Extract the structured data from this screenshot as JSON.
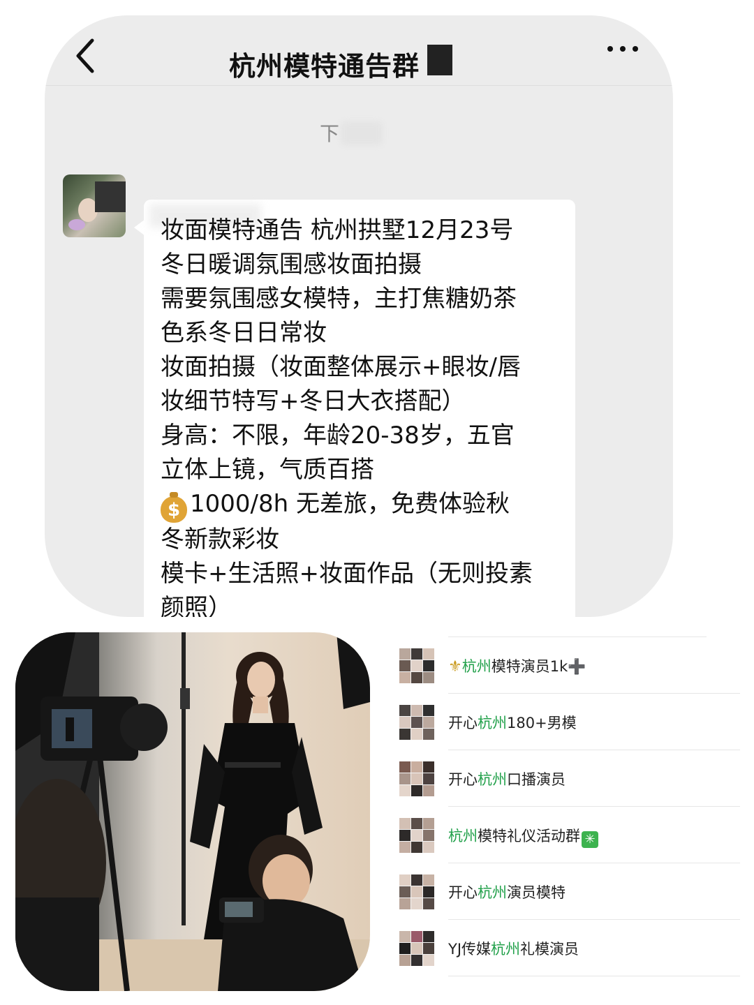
{
  "chat": {
    "title": "杭州模特通告群",
    "time_label": "下",
    "message_lines": [
      "妆面模特通告 杭州拱墅12月23号",
      "冬日暖调氛围感妆面拍摄",
      "需要氛围感女模特，主打焦糖奶茶",
      "色系冬日日常妆",
      "妆面拍摄（妆面整体展示+眼妆/唇",
      "妆细节特写+冬日大衣搭配）",
      "身高：不限，年龄20-38岁，五官",
      "立体上镜，气质百搭",
      "1000/8h 无差旅，免费体验秋",
      "冬新款彩妆",
      "模卡+生活照+妆面作品（无则投素",
      "颜照）"
    ],
    "money_icon": "money-bag-icon",
    "money_glyph": "$"
  },
  "group_list": [
    {
      "prefix_icon": "⚜",
      "pre": "",
      "highlight": "杭州",
      "post": "模特演员1k",
      "suffix": "➕"
    },
    {
      "prefix_icon": "",
      "pre": "开心",
      "highlight": "杭州",
      "post": "180+男模",
      "suffix": ""
    },
    {
      "prefix_icon": "",
      "pre": "开心",
      "highlight": "杭州",
      "post": "口播演员",
      "suffix": ""
    },
    {
      "prefix_icon": "",
      "pre": "",
      "highlight": "杭州",
      "post": "模特礼仪活动群",
      "suffix": "✳"
    },
    {
      "prefix_icon": "",
      "pre": "开心",
      "highlight": "杭州",
      "post": "演员模特",
      "suffix": ""
    },
    {
      "prefix_icon": "",
      "pre": "YJ传媒",
      "highlight": "杭州",
      "post": "礼模演员",
      "suffix": ""
    }
  ],
  "colors": {
    "highlight": "#21a04a",
    "chat_background": "#ececec",
    "bubble": "#ffffff"
  }
}
